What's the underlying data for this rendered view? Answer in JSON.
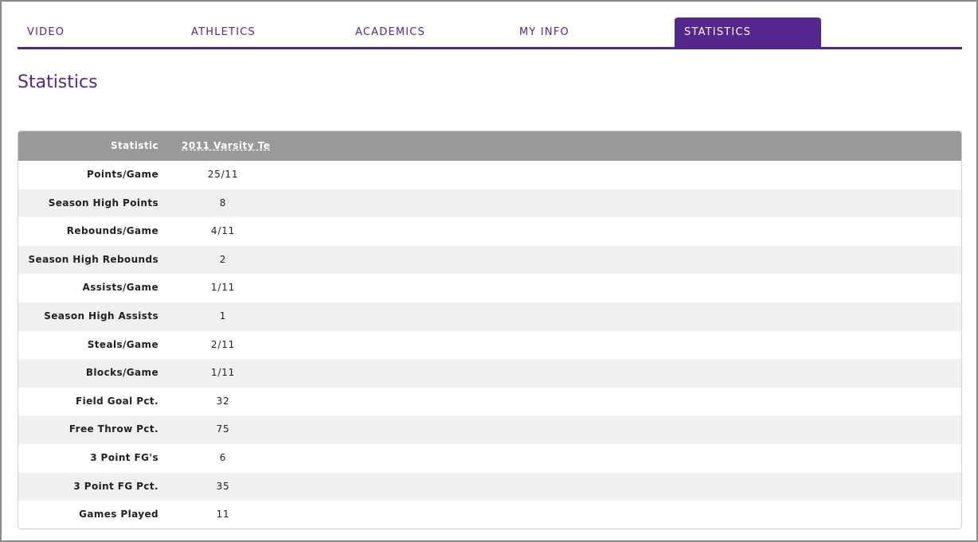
{
  "tabs": [
    {
      "label": "VIDEO",
      "active": false
    },
    {
      "label": "ATHLETICS",
      "active": false
    },
    {
      "label": "ACADEMICS",
      "active": false
    },
    {
      "label": "MY INFO",
      "active": false
    },
    {
      "label": "STATISTICS",
      "active": true
    }
  ],
  "page": {
    "title": "Statistics"
  },
  "table": {
    "header_label": "Statistic",
    "column_label": "2011 Varsity Te",
    "rows": [
      {
        "label": "Points/Game",
        "value": "25/11"
      },
      {
        "label": "Season High Points",
        "value": "8"
      },
      {
        "label": "Rebounds/Game",
        "value": "4/11"
      },
      {
        "label": "Season High Rebounds",
        "value": "2"
      },
      {
        "label": "Assists/Game",
        "value": "1/11"
      },
      {
        "label": "Season High Assists",
        "value": "1"
      },
      {
        "label": "Steals/Game",
        "value": "2/11"
      },
      {
        "label": "Blocks/Game",
        "value": "1/11"
      },
      {
        "label": "Field Goal Pct.",
        "value": "32"
      },
      {
        "label": "Free Throw Pct.",
        "value": "75"
      },
      {
        "label": "3 Point FG's",
        "value": "6"
      },
      {
        "label": "3 Point FG Pct.",
        "value": "35"
      },
      {
        "label": "Games Played",
        "value": "11"
      }
    ]
  },
  "colors": {
    "accent": "#54278f",
    "header_bg": "#999999",
    "row_alt": "#f0f0f0"
  }
}
